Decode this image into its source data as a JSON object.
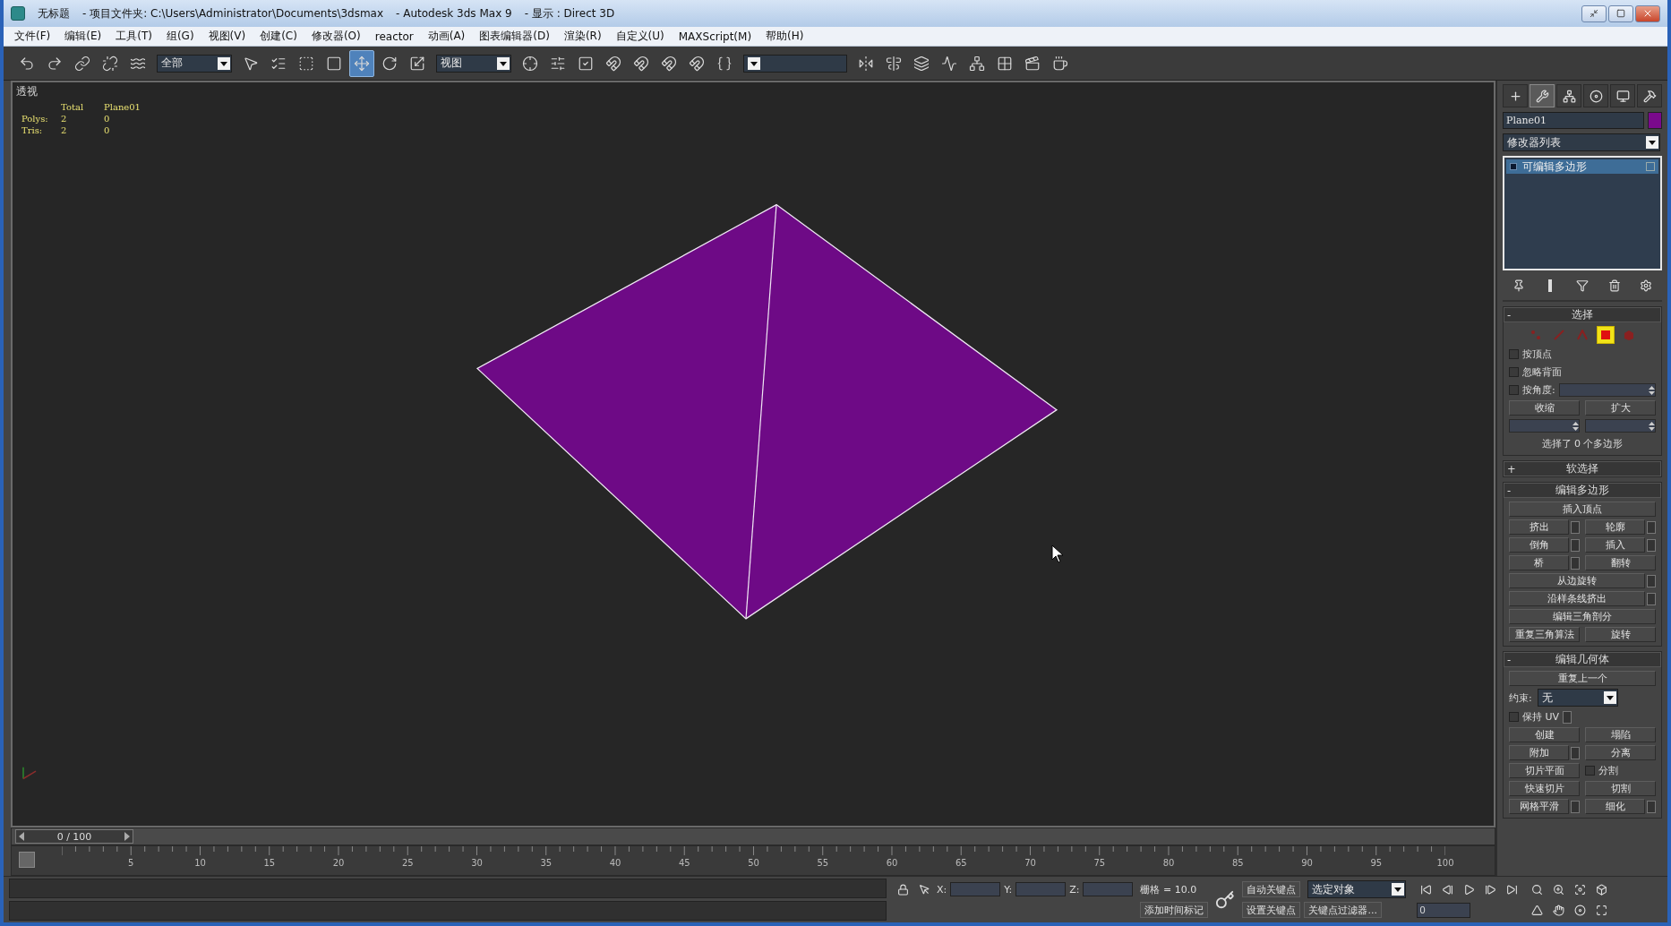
{
  "window": {
    "title_parts": [
      "无标题",
      "- 项目文件夹: C:\\Users\\Administrator\\Documents\\3dsmax",
      "- Autodesk 3ds Max 9",
      "- 显示 : Direct 3D"
    ]
  },
  "menu": [
    "文件(F)",
    "编辑(E)",
    "工具(T)",
    "组(G)",
    "视图(V)",
    "创建(C)",
    "修改器(O)",
    "reactor",
    "动画(A)",
    "图表编辑器(D)",
    "渲染(R)",
    "自定义(U)",
    "MAXScript(M)",
    "帮助(H)"
  ],
  "toolbar": [
    {
      "kind": "undo",
      "selected": false
    },
    {
      "kind": "redo",
      "selected": false
    },
    {
      "kind": "link",
      "selected": false
    },
    {
      "kind": "unlink",
      "selected": false
    },
    {
      "kind": "bind",
      "selected": false
    },
    {
      "kind": "dropdown",
      "value": "全部"
    },
    {
      "kind": "select",
      "selected": false
    },
    {
      "kind": "select-by-name",
      "selected": false
    },
    {
      "kind": "region",
      "selected": false
    },
    {
      "kind": "crossing",
      "selected": false
    },
    {
      "kind": "move",
      "selected": true
    },
    {
      "kind": "rotate",
      "selected": false
    },
    {
      "kind": "scale",
      "selected": false
    },
    {
      "kind": "dropdown",
      "value": "视图"
    },
    {
      "kind": "pivot",
      "selected": false
    },
    {
      "kind": "keyboard",
      "selected": false
    },
    {
      "kind": "manipulate",
      "selected": false
    },
    {
      "kind": "snap",
      "selected": false
    },
    {
      "kind": "angle-snap",
      "selected": false
    },
    {
      "kind": "percent-snap",
      "selected": false
    },
    {
      "kind": "spinner-snap",
      "selected": false
    },
    {
      "kind": "named-sets",
      "selected": false
    },
    {
      "kind": "dropdown"
    },
    {
      "kind": "mirror",
      "selected": false
    },
    {
      "kind": "align",
      "selected": false
    },
    {
      "kind": "layers",
      "selected": false
    },
    {
      "kind": "curve-editor",
      "selected": false
    },
    {
      "kind": "schematic",
      "selected": false
    },
    {
      "kind": "material",
      "selected": false
    },
    {
      "kind": "render-setup",
      "selected": false
    },
    {
      "kind": "quick-render",
      "selected": false
    }
  ],
  "viewport": {
    "label": "透视",
    "stats": {
      "columns": [
        "Total",
        "Plane01"
      ],
      "rows": [
        {
          "label": "Polys:",
          "values": [
            "2",
            "0"
          ]
        },
        {
          "label": "Tris:",
          "values": [
            "2",
            "0"
          ]
        }
      ]
    }
  },
  "command_panel": {
    "tabs": [
      {
        "kind": "create",
        "selected": false
      },
      {
        "kind": "modify",
        "selected": true
      },
      {
        "kind": "hierarchy",
        "selected": false
      },
      {
        "kind": "motion",
        "selected": false
      },
      {
        "kind": "display",
        "selected": false
      },
      {
        "kind": "utilities",
        "selected": false
      }
    ],
    "object_name": "Plane01",
    "modifier_list": "修改器列表",
    "stack": [
      {
        "label": "可编辑多边形",
        "selected": true
      }
    ],
    "rollouts": [
      {
        "sign": "-",
        "title": "选择",
        "rows": [
          [
            {
              "kind": "levels",
              "levels": [
                {
                  "kind": "vertex",
                  "selected": false
                },
                {
                  "kind": "edge",
                  "selected": false
                },
                {
                  "kind": "border",
                  "selected": false
                },
                {
                  "kind": "polygon",
                  "selected": true
                },
                {
                  "kind": "element",
                  "selected": false
                }
              ]
            }
          ],
          [
            {
              "kind": "checkbox",
              "label": "按顶点",
              "checked": false
            }
          ],
          [
            {
              "kind": "checkbox",
              "label": "忽略背面",
              "checked": false
            }
          ],
          [
            {
              "kind": "checkbox",
              "label": "按角度:",
              "checked": false,
              "spinner": true
            }
          ],
          [
            {
              "kind": "button",
              "label": "收缩"
            },
            {
              "kind": "button",
              "label": "扩大"
            }
          ],
          [
            {
              "kind": "spinner"
            },
            {
              "kind": "spinner"
            }
          ],
          [
            {
              "kind": "text",
              "label": "选择了 0 个多边形"
            }
          ]
        ]
      },
      {
        "sign": "+",
        "title": "软选择"
      },
      {
        "sign": "-",
        "title": "编辑多边形",
        "rows": [
          [
            {
              "kind": "button",
              "label": "插入顶点"
            }
          ],
          [
            {
              "kind": "button",
              "label": "挤出",
              "settings": true
            },
            {
              "kind": "button",
              "label": "轮廓",
              "settings": true
            }
          ],
          [
            {
              "kind": "button",
              "label": "倒角",
              "settings": true
            },
            {
              "kind": "button",
              "label": "插入",
              "settings": true
            }
          ],
          [
            {
              "kind": "button",
              "label": "桥",
              "settings": true
            },
            {
              "kind": "button",
              "label": "翻转"
            }
          ],
          [
            {
              "kind": "button",
              "label": "从边旋转",
              "settings": true
            }
          ],
          [
            {
              "kind": "button",
              "label": "沿样条线挤出",
              "settings": true
            }
          ],
          [
            {
              "kind": "button",
              "label": "编辑三角剖分"
            }
          ],
          [
            {
              "kind": "button",
              "label": "重复三角算法"
            },
            {
              "kind": "button",
              "label": "旋转"
            }
          ]
        ]
      },
      {
        "sign": "-",
        "title": "编辑几何体",
        "rows": [
          [
            {
              "kind": "button",
              "label": "重复上一个"
            }
          ],
          [
            {
              "kind": "dropdown",
              "label": "约束:",
              "value": "无"
            }
          ],
          [
            {
              "kind": "checkbox",
              "label": "保持 UV",
              "checked": false,
              "settings": true
            }
          ],
          [
            {
              "kind": "button",
              "label": "创建"
            },
            {
              "kind": "button",
              "label": "塌陷"
            }
          ],
          [
            {
              "kind": "button",
              "label": "附加",
              "settings": true
            },
            {
              "kind": "button",
              "label": "分离"
            }
          ],
          [
            {
              "kind": "button",
              "label": "切片平面"
            },
            {
              "kind": "checkbox",
              "label": "分割",
              "checked": false
            }
          ],
          [
            {
              "kind": "button",
              "label": "快速切片"
            },
            {
              "kind": "button",
              "label": "切割"
            }
          ],
          [
            {
              "kind": "button",
              "label": "网格平滑",
              "settings": true
            },
            {
              "kind": "button",
              "label": "细化",
              "settings": true
            }
          ]
        ]
      }
    ]
  },
  "time_slider": {
    "label": "0 / 100",
    "level": 0
  },
  "ruler": [
    "5",
    "10",
    "15",
    "20",
    "25",
    "30",
    "35",
    "40",
    "45",
    "50",
    "55",
    "60",
    "65",
    "70",
    "75",
    "80",
    "85",
    "90",
    "95",
    "100"
  ],
  "status_bar": {
    "coords": [
      "X:",
      "Y:",
      "Z:"
    ],
    "grid": "栅格 = 10.0",
    "add_time_tag": "添加时间标记",
    "auto_key": "自动关键点",
    "key_mode": "选定对象",
    "set_key": "设置关键点",
    "key_filters": "关键点过滤器...",
    "frame": "0"
  }
}
